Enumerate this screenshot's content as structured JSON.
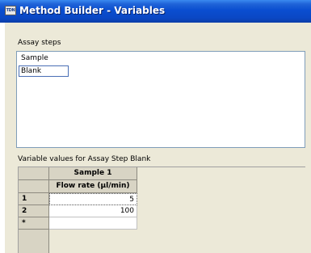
{
  "window": {
    "app_icon_text": "TDN",
    "title": "Method Builder - Variables"
  },
  "assay_steps": {
    "label": "Assay steps",
    "items": [
      {
        "label": "Sample",
        "selected": false
      },
      {
        "label": "Blank",
        "selected": true
      }
    ]
  },
  "variables": {
    "label": "Variable values for Assay Step Blank",
    "column_group": "Sample 1",
    "column_header": "Flow rate (µl/min)",
    "rows": [
      {
        "row_label": "1",
        "value": "5"
      },
      {
        "row_label": "2",
        "value": "100"
      },
      {
        "row_label": "*",
        "value": ""
      }
    ]
  }
}
